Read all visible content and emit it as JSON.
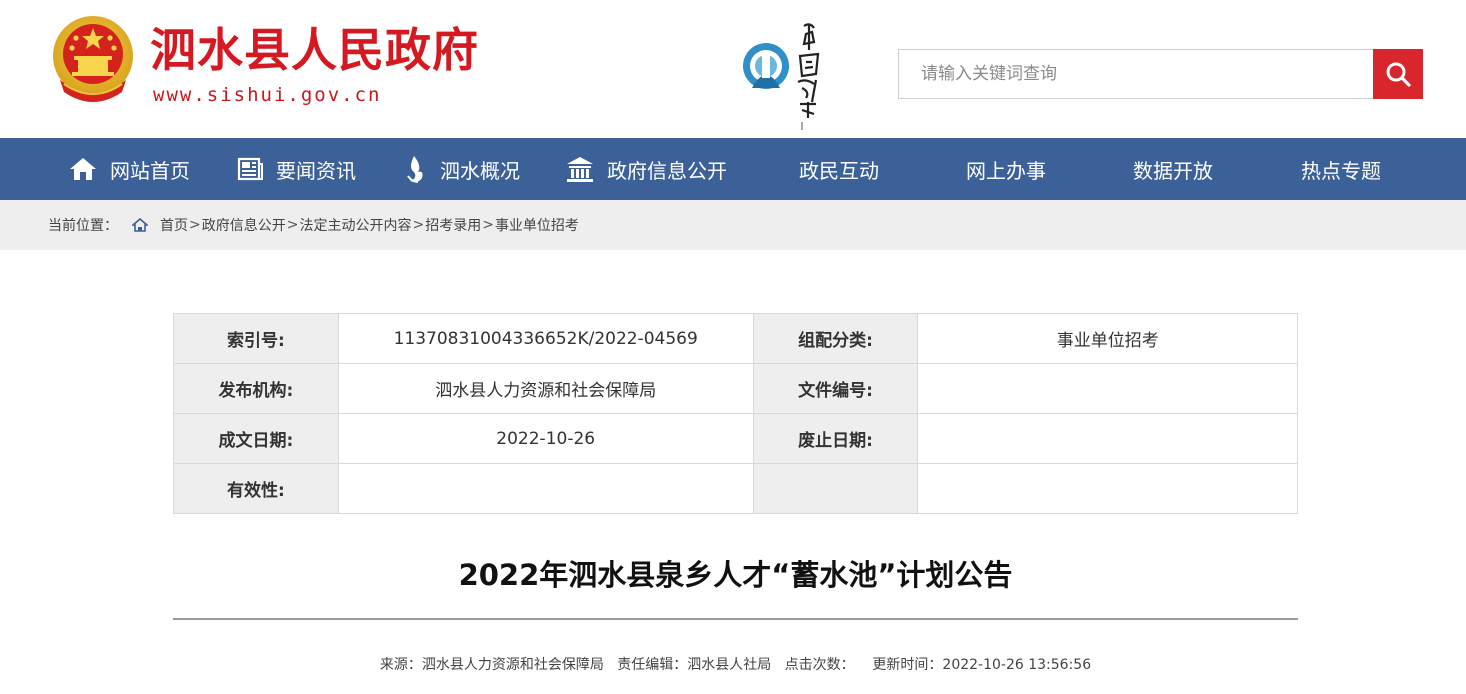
{
  "header": {
    "site_title": "泗水县人民政府",
    "site_url": "www.sishui.gov.cn",
    "brand_logo_text": "中国泉乡",
    "search_placeholder": "请输入关键词查询"
  },
  "nav": {
    "items": [
      {
        "label": "网站首页",
        "icon": "home-icon"
      },
      {
        "label": "要闻资讯",
        "icon": "news-icon"
      },
      {
        "label": "泗水概况",
        "icon": "water-drop-icon"
      },
      {
        "label": "政府信息公开",
        "icon": "government-building-icon"
      },
      {
        "label": "政民互动"
      },
      {
        "label": "网上办事"
      },
      {
        "label": "数据开放"
      },
      {
        "label": "热点专题"
      }
    ]
  },
  "breadcrumb": {
    "prefix": "当前位置：",
    "items": [
      "首页",
      "政府信息公开",
      "法定主动公开内容",
      "招考录用",
      "事业单位招考"
    ],
    "separator": ">"
  },
  "info_table": {
    "rows": [
      [
        {
          "label": "索引号:",
          "value": "11370831004336652K/2022-04569"
        },
        {
          "label": "组配分类:",
          "value": "事业单位招考"
        }
      ],
      [
        {
          "label": "发布机构:",
          "value": "泗水县人力资源和社会保障局"
        },
        {
          "label": "文件编号:",
          "value": ""
        }
      ],
      [
        {
          "label": "成文日期:",
          "value": "2022-10-26"
        },
        {
          "label": "废止日期:",
          "value": ""
        }
      ],
      [
        {
          "label": "有效性:",
          "value": ""
        },
        {
          "label": "",
          "value": ""
        }
      ]
    ]
  },
  "article": {
    "title": "2022年泗水县泉乡人才“蓄水池”计划公告",
    "source_label": "来源：",
    "source": "泗水县人力资源和社会保障局",
    "editor_label": "责任编辑：",
    "editor": "泗水县人社局",
    "clicks_label": "点击次数：",
    "clicks": "",
    "updated_label": "更新时间：",
    "updated": "2022-10-26 13:56:56"
  },
  "colors": {
    "brand_red": "#d41920",
    "nav_blue": "#3c6198",
    "search_red": "#d9262c",
    "label_bg": "#eeeeee"
  }
}
